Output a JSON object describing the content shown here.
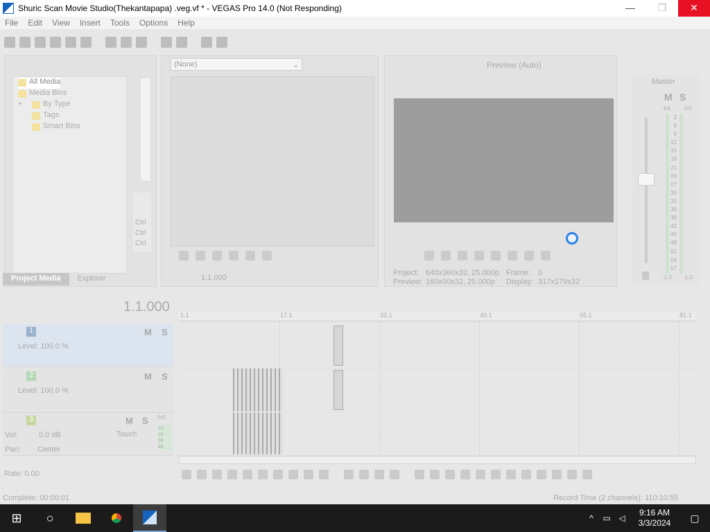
{
  "window": {
    "title": "Shuric Scan Movie Studio(Thekantapapa) .veg.vf * - VEGAS Pro 14.0 (Not Responding)",
    "minimize": "—",
    "maximize": "❐",
    "close": "✕"
  },
  "menu": [
    "File",
    "Edit",
    "View",
    "Insert",
    "Tools",
    "Options",
    "Help"
  ],
  "project_media": {
    "tree": [
      {
        "label": "All Media"
      },
      {
        "label": "Media Bins"
      },
      {
        "label": "By Type",
        "expander": "+"
      },
      {
        "label": "Tags"
      },
      {
        "label": "Smart Bins"
      }
    ],
    "tabs": [
      "Project Media",
      "Explorer"
    ],
    "ctrl_labels": [
      "Ctrl",
      "Ctrl",
      "Ctrl"
    ]
  },
  "trimmer": {
    "dropdown_value": "(None)",
    "time": "1.1.000"
  },
  "preview": {
    "mode": "Preview (Auto)",
    "project_label": "Project:",
    "project_value": "640x360x32, 25.000p",
    "frame_label": "Frame:",
    "frame_value": "0",
    "preview_label": "Preview:",
    "preview_value": "160x90x32, 25.000p",
    "display_label": "Display:",
    "display_value": "317x179x32"
  },
  "mixer": {
    "master": "Master",
    "m": "M",
    "s": "S",
    "inf_left": "-Inf.",
    "inf_right": "-Inf.",
    "scale": [
      "3",
      "6",
      "9",
      "12",
      "15",
      "18",
      "21",
      "24",
      "27",
      "30",
      "33",
      "36",
      "39",
      "42",
      "45",
      "48",
      "51",
      "54",
      "57"
    ],
    "bottom_left": "-1.0",
    "bottom_right": "-1.0"
  },
  "timeline": {
    "current_time": "1.1.000",
    "ruler": [
      "1.1",
      "17.1",
      "33.1",
      "49.1",
      "65.1",
      "81.1"
    ],
    "tracks": [
      {
        "num": "1",
        "level": "Level: 100.0 %",
        "m": "M",
        "s": "S"
      },
      {
        "num": "2",
        "level": "Level: 100.0 %",
        "m": "M",
        "s": "S"
      }
    ],
    "audio_track": {
      "num": "3",
      "m": "M",
      "s": "S",
      "inf": "-Inf.",
      "vol_label": "Vol:",
      "vol_value": "0.0 dB",
      "pan_label": "Pan:",
      "pan_value": "Center",
      "touch": "Touch",
      "mini_scale": [
        "12",
        "24",
        "36",
        "48"
      ]
    },
    "rate": "Rate: 0.00"
  },
  "status": {
    "complete": "Complete: 00:00:01",
    "record_time": "Record Time (2 channels): 110:10:55"
  },
  "taskbar": {
    "time": "9:16 AM",
    "date": "3/3/2024"
  }
}
